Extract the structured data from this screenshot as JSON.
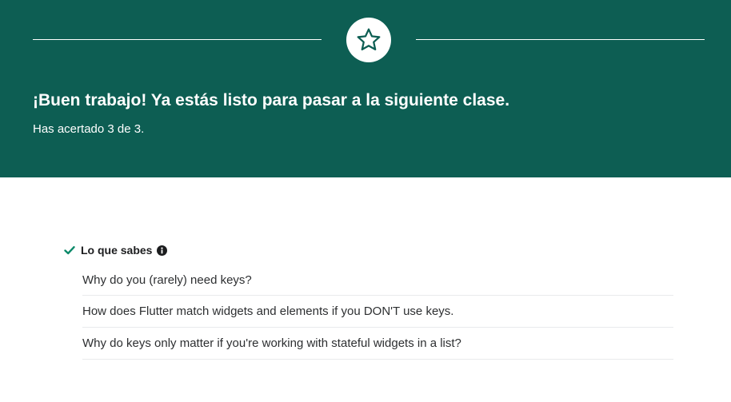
{
  "colors": {
    "banner": "#0d5e53",
    "check": "#0d8a6a",
    "text": "#1c1d1f"
  },
  "banner": {
    "icon": "star-icon",
    "title": "¡Buen trabajo! Ya estás listo para pasar a la siguiente clase.",
    "score_text": "Has acertado 3 de 3."
  },
  "known_section": {
    "status_icon": "check-icon",
    "title": "Lo que sabes",
    "info_icon": "info-icon",
    "items": [
      "Why do you (rarely) need keys?",
      "How does Flutter match widgets and elements if you DON'T use keys.",
      "Why do keys only matter if you're working with stateful widgets in a list?"
    ]
  }
}
